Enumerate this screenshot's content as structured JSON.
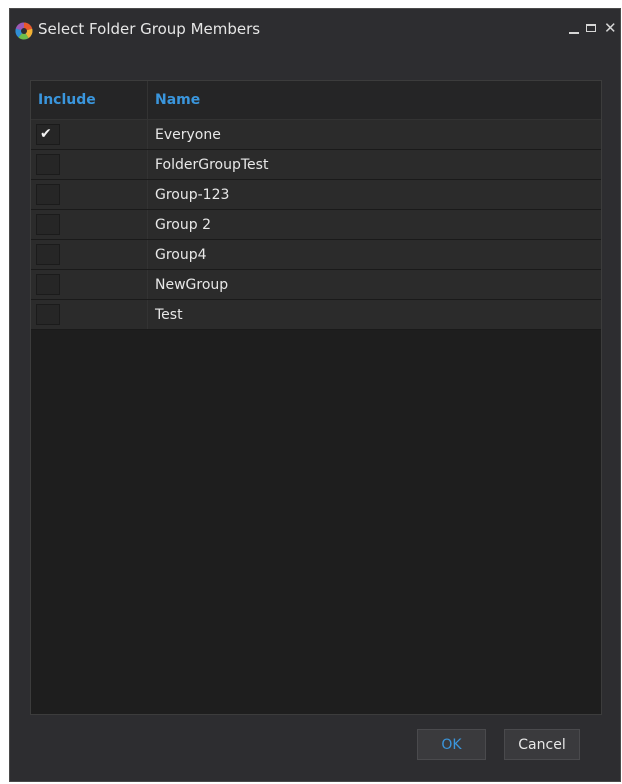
{
  "window": {
    "title": "Select Folder Group Members",
    "controls": {
      "minimize_icon": "minimize-icon",
      "maximize_icon": "maximize-icon",
      "close_glyph": "✕"
    }
  },
  "table": {
    "columns": [
      {
        "label": "Include"
      },
      {
        "label": "Name"
      }
    ],
    "rows": [
      {
        "name": "Everyone",
        "included": true
      },
      {
        "name": "FolderGroupTest",
        "included": false
      },
      {
        "name": "Group-123",
        "included": false
      },
      {
        "name": "Group 2",
        "included": false
      },
      {
        "name": "Group4",
        "included": false
      },
      {
        "name": "NewGroup",
        "included": false
      },
      {
        "name": "Test",
        "included": false
      }
    ]
  },
  "buttons": {
    "ok_label": "OK",
    "cancel_label": "Cancel"
  },
  "colors": {
    "background": "#2d2d30",
    "panel": "#1e1e1e",
    "row": "#2b2b2b",
    "accent": "#3a96dd",
    "text": "#e8e8e8"
  }
}
